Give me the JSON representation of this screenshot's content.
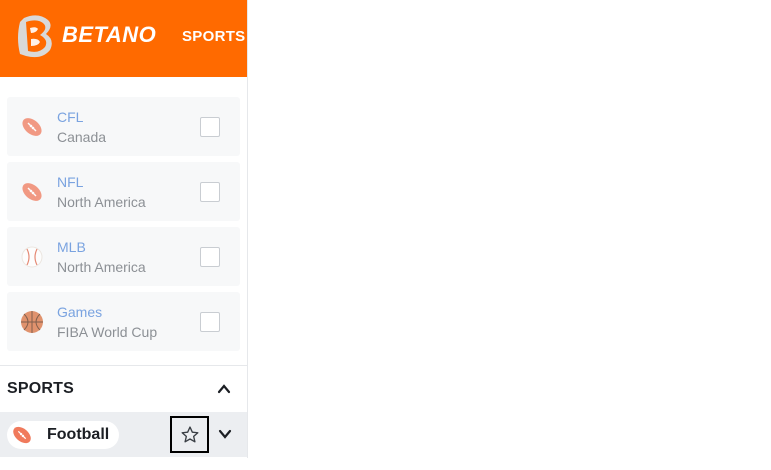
{
  "header": {
    "brand": "BETANO",
    "nav_label": "SPORTS"
  },
  "colors": {
    "brand": "#ff6a00",
    "league_name": "#7aa3e0"
  },
  "leagues": [
    {
      "name": "CFL",
      "region": "Canada",
      "icon": "american-football-icon"
    },
    {
      "name": "NFL",
      "region": "North America",
      "icon": "american-football-icon"
    },
    {
      "name": "MLB",
      "region": "North America",
      "icon": "baseball-icon"
    },
    {
      "name": "Games",
      "region": "FIBA World Cup",
      "icon": "basketball-icon"
    }
  ],
  "sports_section": {
    "title": "SPORTS",
    "items": [
      {
        "label": "Football",
        "icon": "american-football-icon"
      }
    ]
  }
}
